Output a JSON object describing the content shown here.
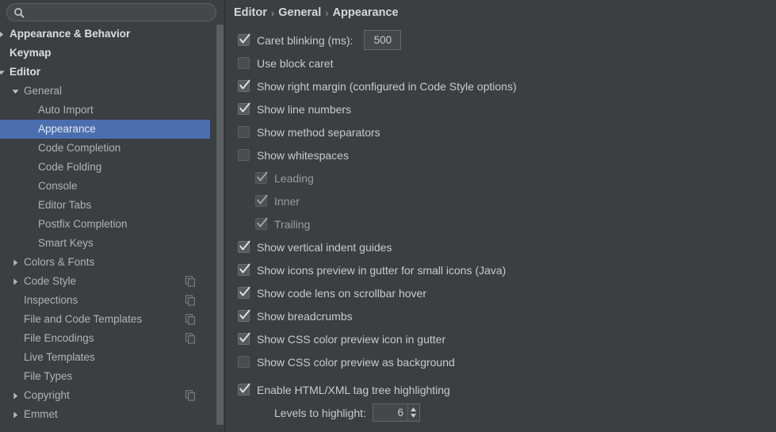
{
  "search": {
    "value": "",
    "placeholder": "",
    "icon": "search-icon"
  },
  "sidebar": {
    "items": [
      {
        "label": "Appearance & Behavior",
        "level": 0,
        "arrow": "collapsed",
        "bold": true,
        "selected": false,
        "copy": false
      },
      {
        "label": "Keymap",
        "level": 0,
        "arrow": "none",
        "bold": true,
        "selected": false,
        "copy": false
      },
      {
        "label": "Editor",
        "level": 0,
        "arrow": "expanded",
        "bold": true,
        "selected": false,
        "copy": false
      },
      {
        "label": "General",
        "level": 1,
        "arrow": "expanded",
        "bold": false,
        "selected": false,
        "copy": false
      },
      {
        "label": "Auto Import",
        "level": 2,
        "arrow": "none",
        "bold": false,
        "selected": false,
        "copy": false
      },
      {
        "label": "Appearance",
        "level": 2,
        "arrow": "none",
        "bold": false,
        "selected": true,
        "copy": false
      },
      {
        "label": "Code Completion",
        "level": 2,
        "arrow": "none",
        "bold": false,
        "selected": false,
        "copy": false
      },
      {
        "label": "Code Folding",
        "level": 2,
        "arrow": "none",
        "bold": false,
        "selected": false,
        "copy": false
      },
      {
        "label": "Console",
        "level": 2,
        "arrow": "none",
        "bold": false,
        "selected": false,
        "copy": false
      },
      {
        "label": "Editor Tabs",
        "level": 2,
        "arrow": "none",
        "bold": false,
        "selected": false,
        "copy": false
      },
      {
        "label": "Postfix Completion",
        "level": 2,
        "arrow": "none",
        "bold": false,
        "selected": false,
        "copy": false
      },
      {
        "label": "Smart Keys",
        "level": 2,
        "arrow": "none",
        "bold": false,
        "selected": false,
        "copy": false
      },
      {
        "label": "Colors & Fonts",
        "level": 1,
        "arrow": "collapsed",
        "bold": false,
        "selected": false,
        "copy": false
      },
      {
        "label": "Code Style",
        "level": 1,
        "arrow": "collapsed",
        "bold": false,
        "selected": false,
        "copy": true
      },
      {
        "label": "Inspections",
        "level": 1,
        "arrow": "none",
        "bold": false,
        "selected": false,
        "copy": true
      },
      {
        "label": "File and Code Templates",
        "level": 1,
        "arrow": "none",
        "bold": false,
        "selected": false,
        "copy": true
      },
      {
        "label": "File Encodings",
        "level": 1,
        "arrow": "none",
        "bold": false,
        "selected": false,
        "copy": true
      },
      {
        "label": "Live Templates",
        "level": 1,
        "arrow": "none",
        "bold": false,
        "selected": false,
        "copy": false
      },
      {
        "label": "File Types",
        "level": 1,
        "arrow": "none",
        "bold": false,
        "selected": false,
        "copy": false
      },
      {
        "label": "Copyright",
        "level": 1,
        "arrow": "collapsed",
        "bold": false,
        "selected": false,
        "copy": true
      },
      {
        "label": "Emmet",
        "level": 1,
        "arrow": "collapsed",
        "bold": false,
        "selected": false,
        "copy": false
      }
    ]
  },
  "breadcrumb": {
    "parts": [
      "Editor",
      "General",
      "Appearance"
    ],
    "separator": "›"
  },
  "main": {
    "options": [
      {
        "label": "Caret blinking (ms):",
        "state": "checked",
        "indent": 0,
        "dim": false,
        "control": "textfield",
        "value": "500"
      },
      {
        "label": "Use block caret",
        "state": "unchecked",
        "indent": 0,
        "dim": false,
        "control": "none"
      },
      {
        "label": "Show right margin (configured in Code Style options)",
        "state": "checked",
        "indent": 0,
        "dim": false,
        "control": "none"
      },
      {
        "label": "Show line numbers",
        "state": "checked",
        "indent": 0,
        "dim": false,
        "control": "none"
      },
      {
        "label": "Show method separators",
        "state": "unchecked",
        "indent": 0,
        "dim": false,
        "control": "none"
      },
      {
        "label": "Show whitespaces",
        "state": "unchecked",
        "indent": 0,
        "dim": false,
        "control": "none"
      },
      {
        "label": "Leading",
        "state": "checked-disabled",
        "indent": 1,
        "dim": true,
        "control": "none"
      },
      {
        "label": "Inner",
        "state": "checked-disabled",
        "indent": 1,
        "dim": true,
        "control": "none"
      },
      {
        "label": "Trailing",
        "state": "checked-disabled",
        "indent": 1,
        "dim": true,
        "control": "none"
      },
      {
        "label": "Show vertical indent guides",
        "state": "checked",
        "indent": 0,
        "dim": false,
        "control": "none"
      },
      {
        "label": "Show icons preview in gutter for small icons (Java)",
        "state": "checked",
        "indent": 0,
        "dim": false,
        "control": "none"
      },
      {
        "label": "Show code lens on scrollbar hover",
        "state": "checked",
        "indent": 0,
        "dim": false,
        "control": "none"
      },
      {
        "label": "Show breadcrumbs",
        "state": "checked",
        "indent": 0,
        "dim": false,
        "control": "none"
      },
      {
        "label": "Show CSS color preview icon in gutter",
        "state": "checked",
        "indent": 0,
        "dim": false,
        "control": "none"
      },
      {
        "label": "Show CSS color preview as background",
        "state": "unchecked",
        "indent": 0,
        "dim": false,
        "control": "none"
      },
      {
        "label": "Enable HTML/XML tag tree highlighting",
        "state": "checked",
        "indent": 0,
        "dim": false,
        "control": "none",
        "gap": true
      },
      {
        "label": "Levels to highlight:",
        "state": "none",
        "indent": 1,
        "dim": false,
        "control": "spinner",
        "value": "6"
      }
    ]
  },
  "colors": {
    "background": "#3c3f41",
    "selection": "#4b6eaf",
    "text": "#c8cacb",
    "text_bright": "#dededf",
    "border": "#646769",
    "scrollbar_thumb": "#5b5e60"
  }
}
